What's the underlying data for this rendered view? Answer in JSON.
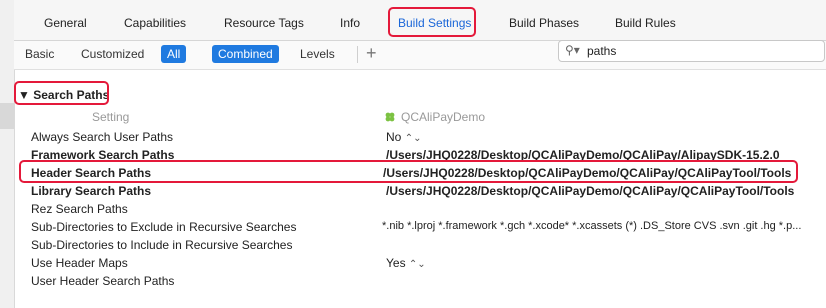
{
  "tabs": [
    {
      "label": "General",
      "active": false
    },
    {
      "label": "Capabilities",
      "active": false
    },
    {
      "label": "Resource Tags",
      "active": false
    },
    {
      "label": "Info",
      "active": false
    },
    {
      "label": "Build Settings",
      "active": true
    },
    {
      "label": "Build Phases",
      "active": false
    },
    {
      "label": "Build Rules",
      "active": false
    }
  ],
  "filters": {
    "basic": "Basic",
    "customized": "Customized",
    "all": "All",
    "combined": "Combined",
    "levels": "Levels",
    "add": "+"
  },
  "search": {
    "value": "paths",
    "icon": "magnifier-dropdown-icon"
  },
  "section": {
    "title": "Search Paths",
    "disclosure": "▼"
  },
  "columns": {
    "setting": "Setting",
    "target": "QCAliPayDemo"
  },
  "rows": [
    {
      "name": "Always Search User Paths",
      "value": "No",
      "bold": false,
      "stepper": true
    },
    {
      "name": "Framework Search Paths",
      "value": "/Users/JHQ0228/Desktop/QCAliPayDemo/QCAliPay/AlipaySDK-15.2.0",
      "bold": true
    },
    {
      "name": "Header Search Paths",
      "value": "/Users/JHQ0228/Desktop/QCAliPayDemo/QCAliPay/QCAliPayTool/Tools",
      "bold": true
    },
    {
      "name": "Library Search Paths",
      "value": "/Users/JHQ0228/Desktop/QCAliPayDemo/QCAliPay/QCAliPayTool/Tools",
      "bold": true
    },
    {
      "name": "Rez Search Paths",
      "value": "",
      "bold": false
    },
    {
      "name": "Sub-Directories to Exclude in Recursive Searches",
      "value": "*.nib *.lproj *.framework *.gch *.xcode* *.xcassets (*) .DS_Store CVS .svn .git .hg *.p...",
      "bold": false
    },
    {
      "name": "Sub-Directories to Include in Recursive Searches",
      "value": "",
      "bold": false
    },
    {
      "name": "Use Header Maps",
      "value": "Yes",
      "bold": false,
      "stepper": true
    },
    {
      "name": "User Header Search Paths",
      "value": "",
      "bold": false
    }
  ],
  "colors": {
    "accent": "#1f7ae0",
    "highlight": "#e4193a",
    "leaf": "#7cc242"
  }
}
